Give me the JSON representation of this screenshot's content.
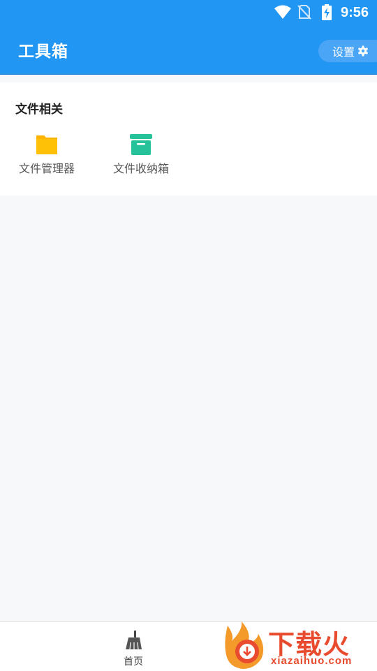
{
  "status_bar": {
    "time": "9:56",
    "icons": [
      "wifi-icon",
      "no-sim-icon",
      "battery-charging-icon"
    ]
  },
  "app_bar": {
    "title": "工具箱",
    "settings_label": "设置",
    "settings_icon": "gear-icon"
  },
  "section": {
    "title": "文件相关",
    "tools": [
      {
        "label": "文件管理器",
        "icon": "folder-icon",
        "color": "#ffb300"
      },
      {
        "label": "文件收纳箱",
        "icon": "archive-box-icon",
        "color": "#26c29a"
      }
    ]
  },
  "bottom_nav": {
    "home_label": "首页",
    "home_icon": "broom-icon"
  },
  "watermark": {
    "brand": "下载火",
    "domain": "xiazaihuo.com"
  },
  "colors": {
    "primary": "#2196f3",
    "background": "#f7f8fa",
    "watermark": "#e94b2e"
  }
}
